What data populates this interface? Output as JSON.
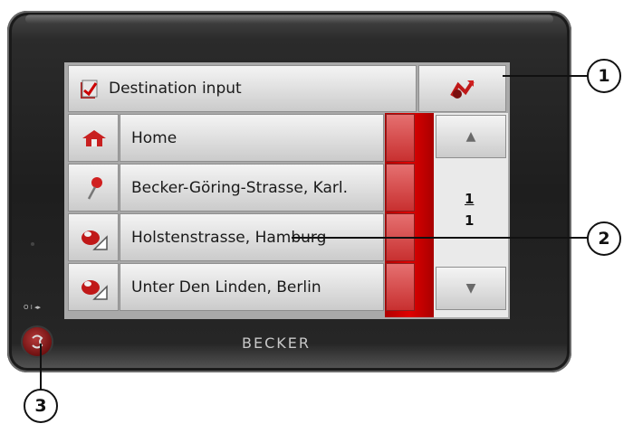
{
  "header": {
    "title": "Destination input"
  },
  "list": {
    "items": [
      {
        "label": "Home",
        "icon": "home-icon"
      },
      {
        "label": "Becker-Göring-Strasse, Karl.",
        "icon": "pin-icon"
      },
      {
        "label": "Holstenstrasse, Hamburg",
        "icon": "destination-icon"
      },
      {
        "label": "Unter Den Linden, Berlin",
        "icon": "destination-icon"
      }
    ]
  },
  "pager": {
    "current": "1",
    "total": "1",
    "up_icon": "▲",
    "down_icon": "▼"
  },
  "device": {
    "brand": "BECKER",
    "power_label": "O I ◂▸"
  },
  "callouts": [
    "1",
    "2",
    "3"
  ],
  "colors": {
    "accent_red": "#d40000",
    "bezel": "#222222"
  }
}
